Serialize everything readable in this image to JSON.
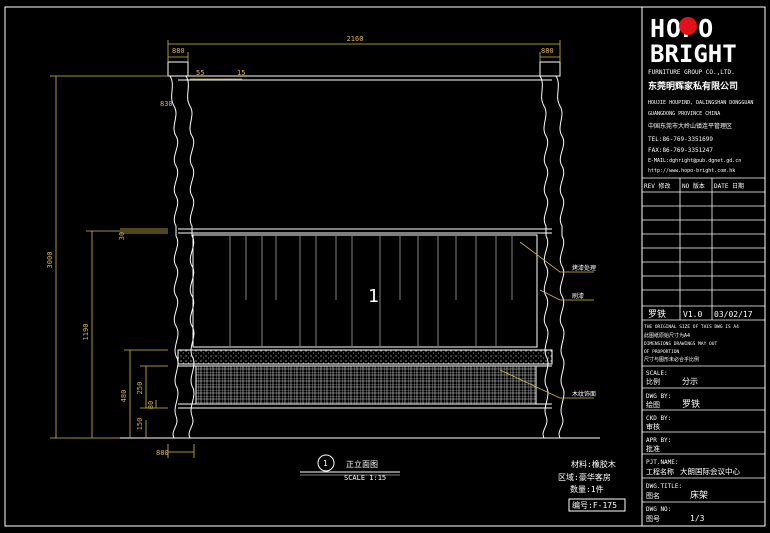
{
  "colors": {
    "background": "#000000",
    "lines": "#ffffff",
    "dimensions": "#d9b84a",
    "logo_red": "#e0121a"
  },
  "dimensions": {
    "overall_width": "2160",
    "post_left": "880",
    "post_right": "880",
    "small_1": "55",
    "small_2": "15",
    "top_rail": "830",
    "overall_height": "3000",
    "mid_height": "1190",
    "rail_gap": "30",
    "base_1": "480",
    "base_2": "250",
    "base_3": "80",
    "base_4": "150",
    "bottom_post": "880"
  },
  "annotations": {
    "label_1": "烤漆处理",
    "label_2": "刷漆",
    "label_3": "木纹饰面"
  },
  "center_mark": "1",
  "view_title": {
    "number": "1",
    "title": "正立面图",
    "scale": "SCALE 1:15"
  },
  "material_note": {
    "material": "材料:橡胶木",
    "area": "区域:豪华客房",
    "qty": "数量:1件",
    "code": "编号:F-175"
  },
  "title_block": {
    "logo_hopo": "HOPO",
    "logo_bright": "BRIGHT",
    "company_en": "FURNITURE GROUP CO.,LTD.",
    "company_cn": "东莞明辉家私有限公司",
    "addr_1": "HOUJIE HOUPIND, DALINGSHAN DONGGUAN",
    "addr_2": "GUANGDONG PROVINCE CHINA",
    "addr_cn": "中国东莞市大岭山镇连平管理区",
    "tel": "TEL:86-769-3351699",
    "fax": "FAX:86-769-3351247",
    "email": "E-MAIL:dghright@pub.dgnet.gd.cn",
    "web": "http://www.hopo-bright.com.hk",
    "rev_headers": [
      "REV 修改",
      "NO 版本",
      "DATE 日期"
    ],
    "revision": {
      "author": "罗铁",
      "version": "V1.0",
      "date": "03/02/17"
    },
    "notice_1": "THE ORIGINAL SIZE OF THIS DWG IS A4",
    "notice_2": "此图纸原始尺寸为A4",
    "notice_3": "DIMENSIONS DRAWINGS MAY OUT",
    "notice_4": "OF PROPORTION",
    "notice_5": "尺寸与图形未必合乎比例",
    "scale_label": "SCALE:",
    "scale_cn": "比例",
    "scale_value": "分示",
    "dwg_by_label": "DWG BY:",
    "dwg_by_cn": "绘图",
    "dwg_by_value": "罗铁",
    "chk_by_label": "CKD BY:",
    "chk_by_cn": "审核",
    "apr_by_label": "APR BY:",
    "apr_by_cn": "批准",
    "prj_label": "PJT.NAME:",
    "prj_cn": "工程名称",
    "prj_value": "大朗国际会议中心",
    "title_label": "DWG.TITLE:",
    "title_cn": "图名",
    "title_value": "床架",
    "dwgno_label": "DWG NO:",
    "dwgno_cn": "图号",
    "dwgno_value": "1/3"
  }
}
